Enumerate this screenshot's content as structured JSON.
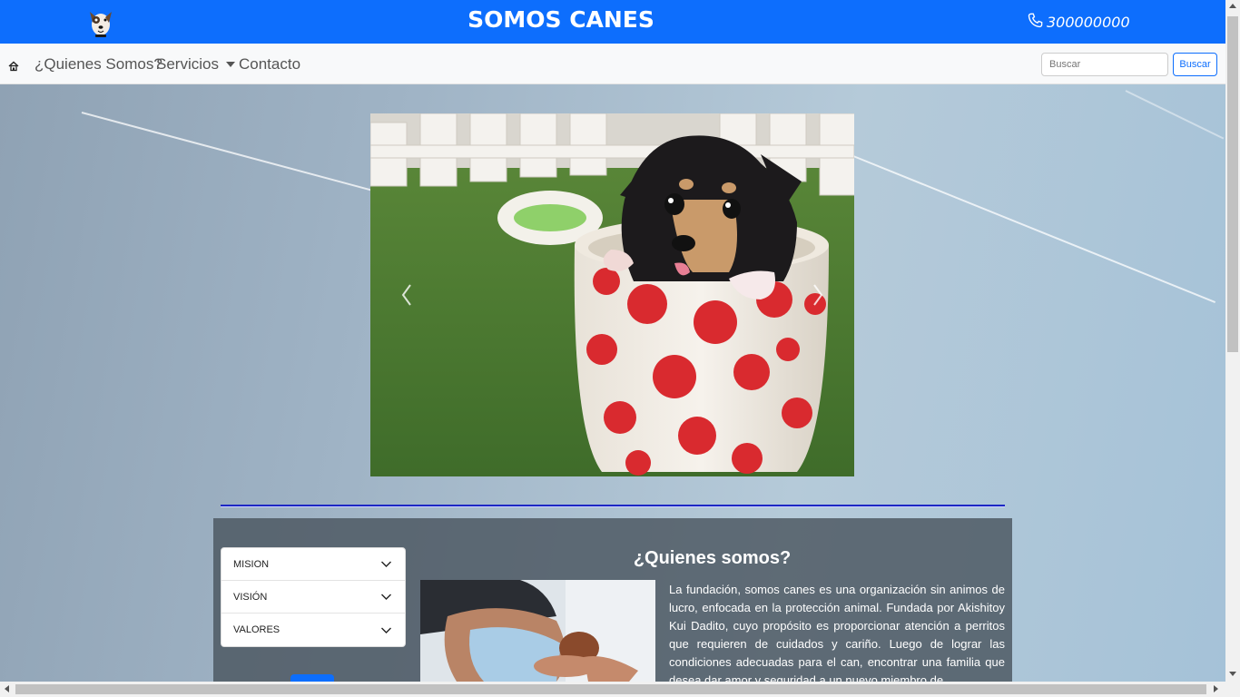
{
  "header": {
    "title": "SOMOS CANES",
    "phone": "300000000",
    "logo_icon": "dog-logo-icon",
    "phone_icon": "phone-icon",
    "brand_color": "#0d6efd"
  },
  "nav": {
    "home_icon": "home-icon",
    "items": [
      {
        "label": "¿Quienes Somos?"
      },
      {
        "label": "Servicios"
      },
      {
        "label": "Contacto"
      }
    ],
    "search_placeholder": "Buscar",
    "search_button": "Buscar"
  },
  "carousel": {
    "prev_icon": "chevron-left-icon",
    "next_icon": "chevron-right-icon",
    "image_subject": "puppy-in-polka-dot-cup"
  },
  "accordion": {
    "items": [
      {
        "label": "MISION"
      },
      {
        "label": "VISIÓN"
      },
      {
        "label": "VALORES"
      }
    ]
  },
  "about": {
    "title": "¿Quienes somos?",
    "text": "La fundación, somos canes es una organización sin animos de lucro, enfocada en la protección animal. Fundada por Akishitoy Kui Dadito, cuyo propósito es proporcionar atención a perritos que requieren de cuidados y cariño. Luego de lograr las condiciones adecuadas para el can, encontrar una familia que desea dar amor y seguridad a un nuevo miembro de"
  }
}
